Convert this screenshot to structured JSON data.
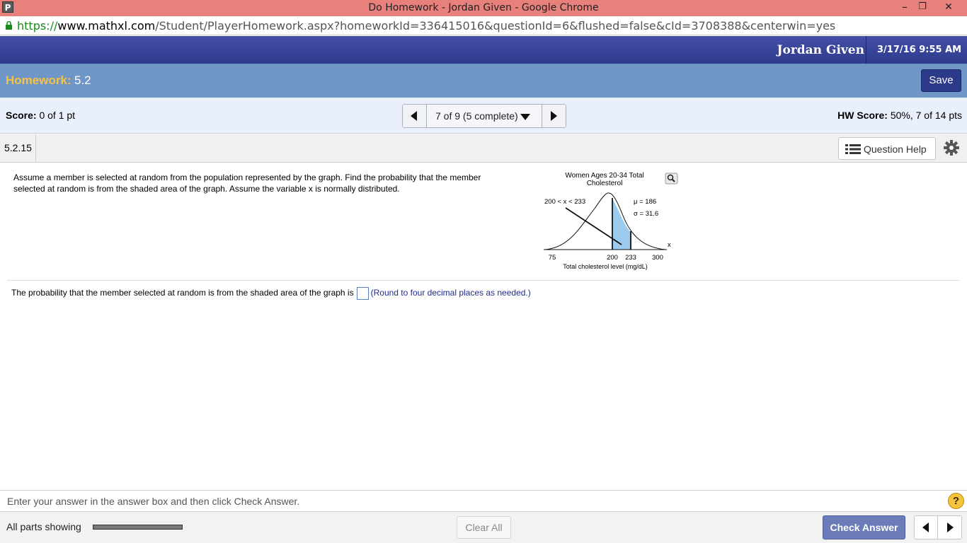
{
  "window": {
    "app_icon_letter": "P",
    "title": "Do Homework - Jordan Given - Google Chrome",
    "min": "–",
    "max": "❐",
    "close": "✕"
  },
  "address": {
    "scheme": "https://",
    "host": "www.mathxl.com",
    "path": "/Student/PlayerHomework.aspx?homeworkId=336415016&questionId=6&flushed=false&cId=3708388&centerwin=yes"
  },
  "user": {
    "name": "Jordan Given",
    "datetime": "3/17/16 9:55 AM"
  },
  "homework": {
    "label": "Homework:",
    "name": "5.2",
    "save_label": "Save"
  },
  "score": {
    "label": "Score:",
    "value": "0 of 1 pt",
    "hw_label": "HW Score:",
    "hw_value": "50%, 7 of 14 pts"
  },
  "question_nav": {
    "current": "7 of 9 (5 complete)"
  },
  "question": {
    "id": "5.2.15",
    "help_label": "Question Help",
    "text": "Assume a member is selected at random from the population represented by the graph. Find the probability that the member selected at random is from the shaded area of the graph. Assume the variable x is normally distributed.",
    "answer_prefix": "The probability that the member selected at random is from the shaded area of the graph is",
    "answer_value": "",
    "answer_hint": "(Round to four decimal places as needed.)"
  },
  "graph": {
    "title_line1": "Women Ages 20-34 Total",
    "title_line2": "Cholesterol",
    "interval": "200 < x < 233",
    "mu": "μ = 186",
    "sigma": "σ = 31.6",
    "x_var": "x",
    "ticks": [
      "75",
      "200",
      "233",
      "300"
    ],
    "xlabel": "Total cholesterol level (mg/dL)",
    "shade_color": "#9ccbee"
  },
  "footer": {
    "instruction": "Enter your answer in the answer box and then click Check Answer.",
    "help_symbol": "?",
    "parts_label": "All parts showing",
    "progress": 1.0,
    "clear_label": "Clear All",
    "check_label": "Check Answer"
  },
  "colors": {
    "title_bar": "#e8807c",
    "user_bar": "#2e3a8c",
    "homework_bar": "#6e97c8",
    "homework_label": "#f7c243",
    "score_bar": "#eaf0fb",
    "check_button": "#6c7cb8"
  }
}
